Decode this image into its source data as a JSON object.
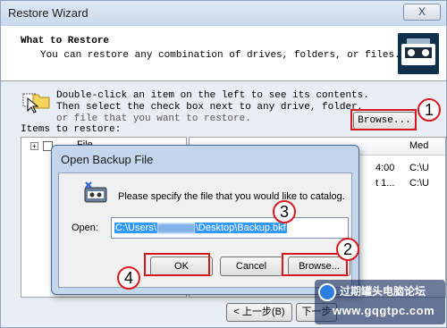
{
  "wizard": {
    "title": "Restore Wizard",
    "close_glyph": "X",
    "header_title": "What to Restore",
    "header_subtitle": "You can restore any combination of drives, folders, or files.",
    "instruction_line1": "Double-click an item on the left to see its contents.",
    "instruction_line2": "Then select the check box next to any drive, folder,",
    "instruction_line3": "or file that you want to restore.",
    "items_label": "Items to restore:",
    "browse_label": "Browse...",
    "tree_item_label": "File",
    "list_columns": [
      "",
      "Med"
    ],
    "list_rows": [
      {
        "time": "4:00",
        "media": "C:\\U"
      },
      {
        "time": "t 1...",
        "media": "C:\\U"
      }
    ],
    "back_label": "< 上一步(B)",
    "next_label": "下一步"
  },
  "dialog": {
    "title": "Open Backup File",
    "message": "Please specify the file that you would like to catalog.",
    "open_label": "Open:",
    "path_value": "C:\\Users\\",
    "path_value_end": "\\Desktop\\Backup.bkf",
    "ok_label": "OK",
    "cancel_label": "Cancel",
    "browse_label": "Browse..."
  },
  "markers": [
    "1",
    "2",
    "3",
    "4"
  ],
  "watermark": {
    "line1": "过期罐头电脑论坛",
    "line2": "www.gqgtpc.com"
  },
  "colors": {
    "annotation_red": "#d6181f",
    "selection_blue": "#3399ff",
    "dialog_frame": "#c3d6ec"
  }
}
